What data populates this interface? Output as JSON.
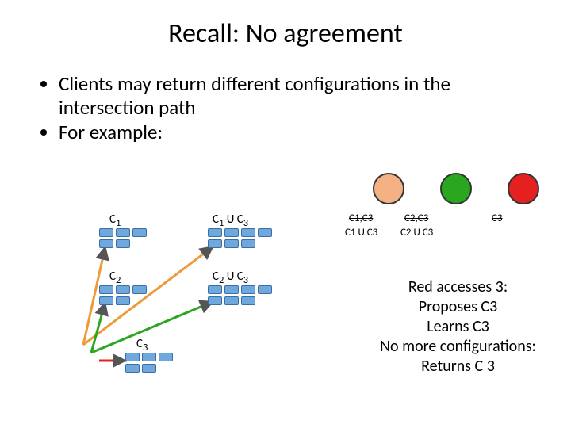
{
  "title": "Recall: No agreement",
  "bullets": [
    "Clients may return different configurations in the intersection path",
    "For example:"
  ],
  "clusters": {
    "left": [
      {
        "label": "C1",
        "sub": "1"
      },
      {
        "label": "C2",
        "sub": "2"
      },
      {
        "label": "C3",
        "sub": "3"
      }
    ],
    "right": [
      {
        "label": "C1 U C3",
        "l": "1",
        "r": "3"
      },
      {
        "label": "C2 U C3",
        "l": "2",
        "r": "3"
      }
    ]
  },
  "discs": [
    {
      "color": "orange",
      "top_strike": "C1,C3",
      "bottom": "C1 U C3"
    },
    {
      "color": "green",
      "top_strike": "C2,C3",
      "bottom": "C2 U C3"
    },
    {
      "color": "red",
      "top_strike": "C3",
      "bottom": ""
    }
  ],
  "red_text": {
    "l1": "Red accesses 3:",
    "l2": "Proposes C3",
    "l3": "Learns C3",
    "l4": "No more configurations:",
    "l5": "Returns C 3"
  }
}
